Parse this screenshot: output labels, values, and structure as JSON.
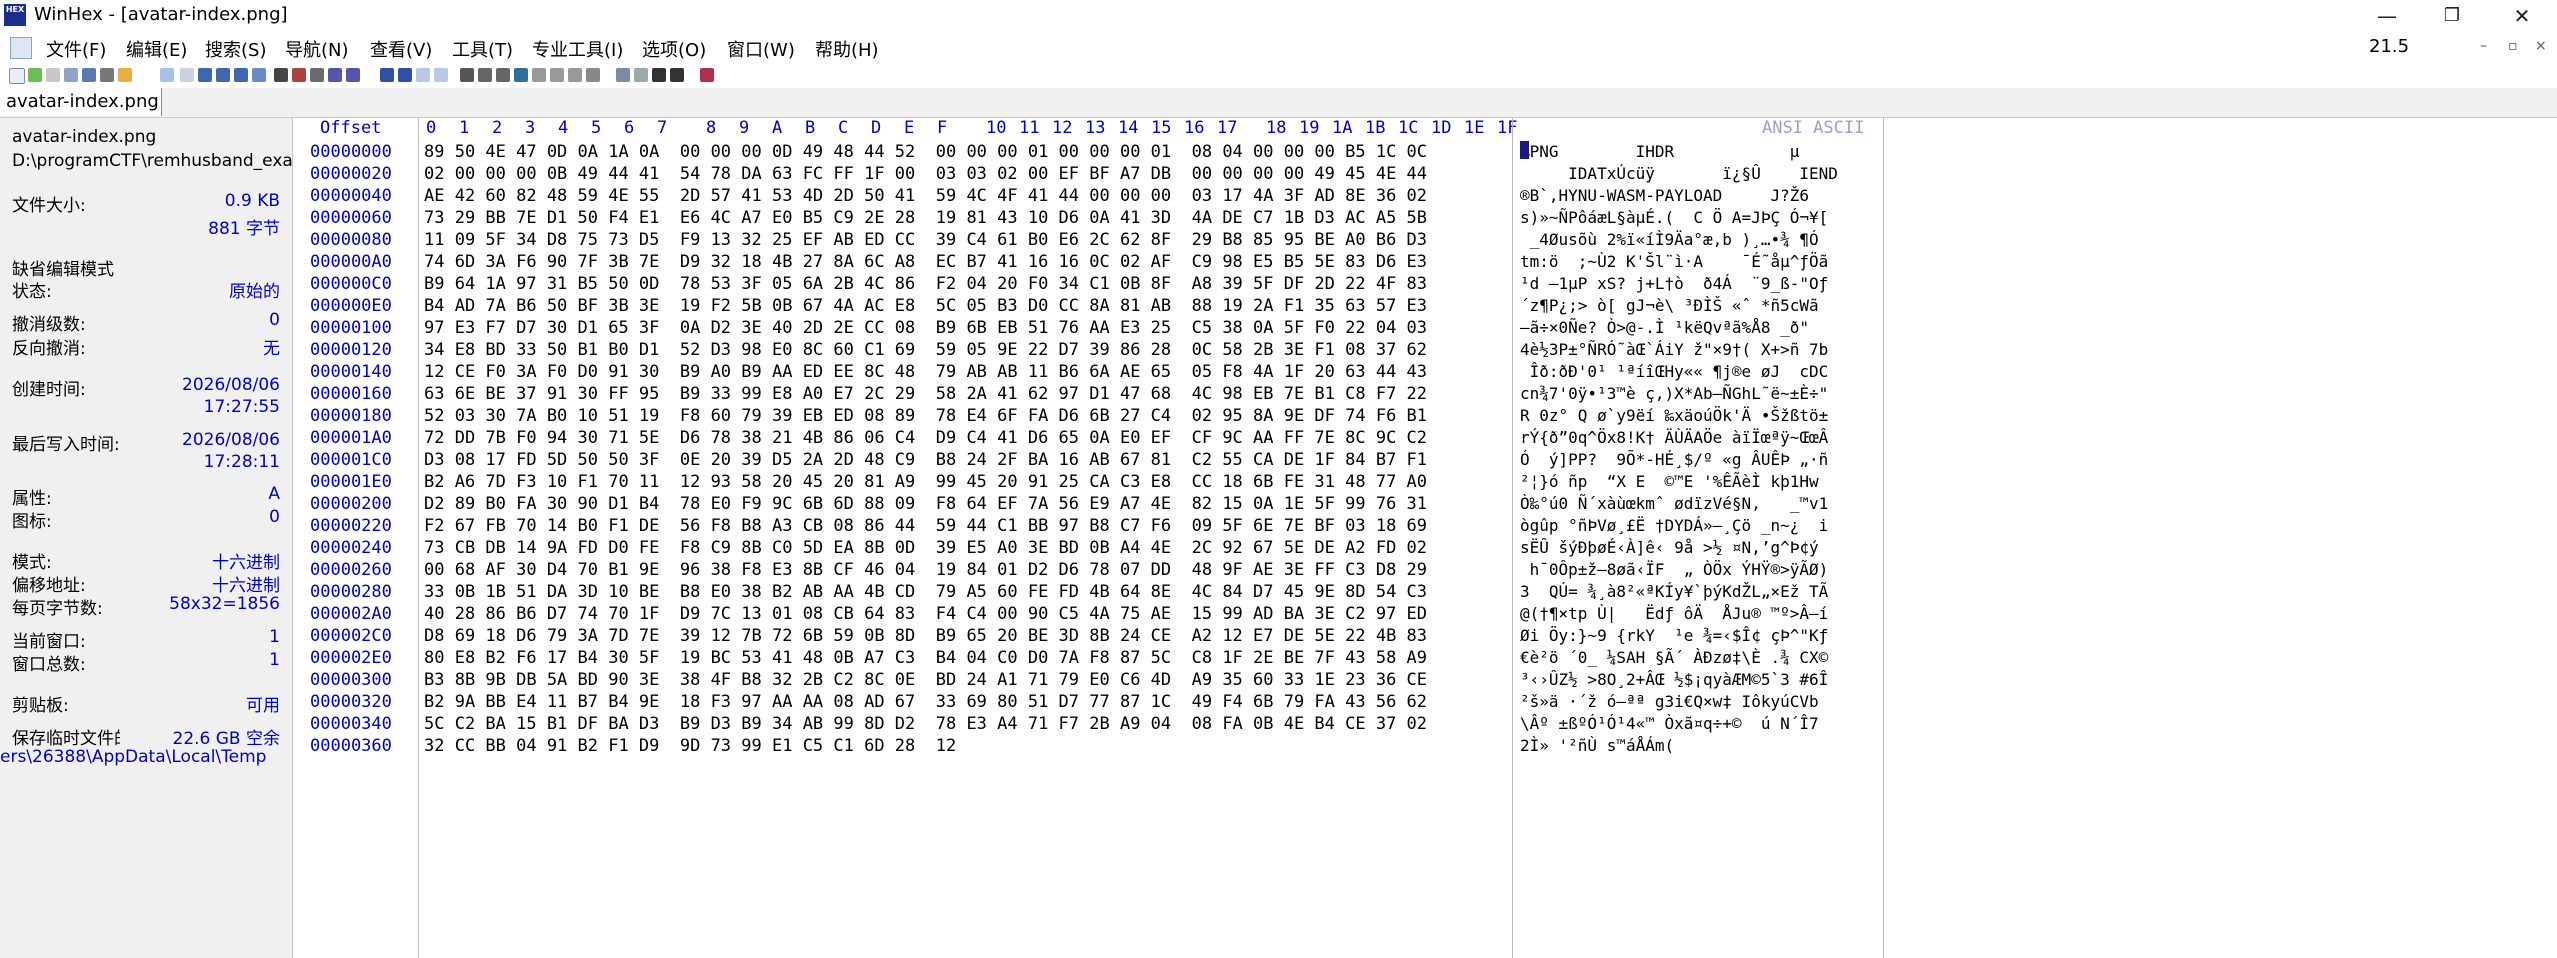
{
  "window": {
    "title": "WinHex - [avatar-index.png]",
    "icon_text": "HEX",
    "min_glyph": "—",
    "restore_glyph": "❐",
    "close_glyph": "✕"
  },
  "menu": [
    "文件(F)",
    "编辑(E)",
    "搜索(S)",
    "导航(N)",
    "查看(V)",
    "工具(T)",
    "专业工具(I)",
    "选项(O)",
    "窗口(W)",
    "帮助(H)"
  ],
  "zoom": "21.5",
  "tab": {
    "label": "avatar-index.png"
  },
  "info": {
    "filename": "avatar-index.png",
    "path": "D:\\programCTF\\remhusband_exa",
    "filesize_label": "文件大小:",
    "filesize_kb": "0.9 KB",
    "filesize_bytes": "881 字节",
    "edit_mode": "缺省编辑模式",
    "state_label": "状态:",
    "state_value": "原始的",
    "undo_label": "撤消级数:",
    "undo_value": "0",
    "redo_label": "反向撤消:",
    "redo_value": "无",
    "created_label": "创建时间:",
    "created_date": "2026/08/06",
    "created_time": "17:27:55",
    "modified_label": "最后写入时间:",
    "modified_date": "2026/08/06",
    "modified_time": "17:28:11",
    "attr_label": "属性:",
    "attr_value": "A",
    "icon_label": "图标:",
    "icon_value": "0",
    "mode_label": "模式:",
    "mode_value": "十六进制",
    "offset_label": "偏移地址:",
    "offset_value": "十六进制",
    "bpp_label": "每页字节数:",
    "bpp_value": "58x32=1856",
    "curwin_label": "当前窗口:",
    "curwin_value": "1",
    "totalwin_label": "窗口总数:",
    "totalwin_value": "1",
    "clip_label": "剪贴板:",
    "clip_value": "可用",
    "temp_label": "保存临时文件的目录为",
    "temp_free": "22.6 GB 空余",
    "temp_path": "ers\\26388\\AppData\\Local\\Temp"
  },
  "hex": {
    "offset_header": "Offset",
    "col_headers": [
      "0",
      "1",
      "2",
      "3",
      "4",
      "5",
      "6",
      "7",
      "8",
      "9",
      "A",
      "B",
      "C",
      "D",
      "E",
      "F",
      "10",
      "11",
      "12",
      "13",
      "14",
      "15",
      "16",
      "17",
      "18",
      "19",
      "1A",
      "1B",
      "1C",
      "1D",
      "1E",
      "1F"
    ],
    "ansi_header": "ANSI ASCII",
    "rows": [
      {
        "o": "00000000",
        "h": "89 50 4E 47 0D 0A 1A 0A  00 00 00 0D 49 48 44 52  00 00 00 01 00 00 00 01  08 04 00 00 00 B5 1C 0C",
        "a": "‰PNG        IHDR            µ"
      },
      {
        "o": "00000020",
        "h": "02 00 00 00 0B 49 44 41  54 78 DA 63 FC FF 1F 00  03 03 02 00 EF BF A7 DB  00 00 00 00 49 45 4E 44",
        "a": "     IDATxÚcüÿ       ï¿§Û    IEND"
      },
      {
        "o": "00000040",
        "h": "AE 42 60 82 48 59 4E 55  2D 57 41 53 4D 2D 50 41  59 4C 4F 41 44 00 00 00  03 17 4A 3F AD 8E 36 02",
        "a": "®B`‚HYNU-WASM-PAYLOAD     J?­Ž6"
      },
      {
        "o": "00000060",
        "h": "73 29 BB 7E D1 50 F4 E1  E6 4C A7 E0 B5 C9 2E 28  19 81 43 10 D6 0A 41 3D  4A DE C7 1B D3 AC A5 5B",
        "a": "s)»~ÑPôáæL§àµÉ.(  C Ö A=JÞÇ Ó¬¥["
      },
      {
        "o": "00000080",
        "h": "11 09 5F 34 D8 75 73 D5  F9 13 32 25 EF AB ED CC  39 C4 61 B0 E6 2C 62 8F  29 B8 85 95 BE A0 B6 D3",
        "a": " _4Øusõù 2%ï«íÌ9Äa°æ,b )¸…•¾ ¶Ó"
      },
      {
        "o": "000000A0",
        "h": "74 6D 3A F6 90 7F 3B 7E  D9 32 18 4B 27 8A 6C A8  EC B7 41 16 16 0C 02 AF  C9 98 E5 B5 5E 83 D6 E3",
        "a": "tm:ö  ;~Ù2 K'Šl¨ì·A    ¯É˜åµ^ƒÖã"
      },
      {
        "o": "000000C0",
        "h": "B9 64 1A 97 31 B5 50 0D  78 53 3F 05 6A 2B 4C 86  F2 04 20 F0 34 C1 0B 8F  A8 39 5F DF 2D 22 4F 83",
        "a": "¹d —1µP xS? j+L†ò  ð4Á  ¨9_ß-\"Oƒ"
      },
      {
        "o": "000000E0",
        "h": "B4 AD 7A B6 50 BF 3B 3E  19 F2 5B 0B 67 4A AC E8  5C 05 B3 D0 CC 8A 81 AB  88 19 2A F1 35 63 57 E3",
        "a": "´­z¶P¿;> ò[ gJ¬è\\ ³ÐÌŠ «ˆ *ñ5cWã"
      },
      {
        "o": "00000100",
        "h": "97 E3 F7 D7 30 D1 65 3F  0A D2 3E 40 2D 2E CC 08  B9 6B EB 51 76 AA E3 25  C5 38 0A 5F F0 22 04 03",
        "a": "—ã÷×0Ñe? Ò>@-.Ì ¹këQvªã%Å8 _ð\""
      },
      {
        "o": "00000120",
        "h": "34 E8 BD 33 50 B1 B0 D1  52 D3 98 E0 8C 60 C1 69  59 05 9E 22 D7 39 86 28  0C 58 2B 3E F1 08 37 62",
        "a": "4è½3P±°ÑRÓ˜àŒ`ÁiY ž\"×9†( X+>ñ 7b"
      },
      {
        "o": "00000140",
        "h": "12 CE F0 3A F0 D0 91 30  B9 A0 B9 AA ED EE 8C 48  79 AB AB 11 B6 6A AE 65  05 F8 4A 1F 20 63 44 43",
        "a": " Îð:ðÐ'0¹ ¹ªíîŒHy«« ¶j®e øJ  cDC"
      },
      {
        "o": "00000160",
        "h": "63 6E BE 37 91 30 FF 95  B9 33 99 E8 A0 E7 2C 29  58 2A 41 62 97 D1 47 68  4C 98 EB 7E B1 C8 F7 22",
        "a": "cn¾7'0ÿ•¹3™è ç,)X*Ab—ÑGhL˜ë~±È÷\""
      },
      {
        "o": "00000180",
        "h": "52 03 30 7A B0 10 51 19  F8 60 79 39 EB ED 08 89  78 E4 6F FA D6 6B 27 C4  02 95 8A 9E DF 74 F6 B1",
        "a": "R 0z° Q ø`y9ëí ‰xäoúÖk'Ä •Šžßtö±"
      },
      {
        "o": "000001A0",
        "h": "72 DD 7B F0 94 30 71 5E  D6 78 38 21 4B 86 06 C4  D9 C4 41 D6 65 0A E0 EF  CF 9C AA FF 7E 8C 9C C2",
        "a": "rÝ{ð”0q^Öx8!K† ÄÙÄAÖe àïÏœªÿ~ŒœÂ"
      },
      {
        "o": "000001C0",
        "h": "D3 08 17 FD 5D 50 50 3F  0E 20 39 D5 2A 2D 48 C9  B8 24 2F BA 16 AB 67 81  C2 55 CA DE 1F 84 B7 F1",
        "a": "Ó  ý]PP?  9Õ*-HÉ¸$/º «g ÂUÊÞ „·ñ"
      },
      {
        "o": "000001E0",
        "h": "B2 A6 7D F3 10 F1 70 11  12 93 58 20 45 20 81 A9  99 45 20 91 25 CA C3 E8  CC 18 6B FE 31 48 77 A0",
        "a": "²¦}ó ñp  “X E  ©™E '%ÊÃèÌ kþ1Hw "
      },
      {
        "o": "00000200",
        "h": "D2 89 B0 FA 30 90 D1 B4  78 E0 F9 9C 6B 6D 88 09  F8 64 EF 7A 56 E9 A7 4E  82 15 0A 1E 5F 99 76 31",
        "a": "Ò‰°ú0 Ñ´xàùœkmˆ ødïzVé§N‚   _™v1"
      },
      {
        "o": "00000220",
        "h": "F2 67 FB 70 14 B0 F1 DE  56 F8 B8 A3 CB 08 86 44  59 44 C1 BB 97 B8 C7 F6  09 5F 6E 7E BF 03 18 69",
        "a": "ògûp °ñÞVø¸£Ë †DYDÁ»—¸Çö _n~¿  i"
      },
      {
        "o": "00000240",
        "h": "73 CB DB 14 9A FD D0 FE  F8 C9 8B C0 5D EA 8B 0D  39 E5 A0 3E BD 0B A4 4E  2C 92 67 5E DE A2 FD 02",
        "a": "sËÛ šýÐþøÉ‹À]ê‹ 9å >½ ¤N,’g^Þ¢ý "
      },
      {
        "o": "00000260",
        "h": "00 68 AF 30 D4 70 B1 9E  96 38 F8 E3 8B CF 46 04  19 84 01 D2 D6 78 07 DD  48 9F AE 3E FF C3 D8 29",
        "a": " h¯0Ôp±ž–8øã‹ÏF  „ ÒÖx ÝHŸ®>ÿÃØ)"
      },
      {
        "o": "00000280",
        "h": "33 0B 1B 51 DA 3D 10 BE  B8 E0 38 B2 AB AA 4B CD  79 A5 60 FE FD 4B 64 8E  4C 84 D7 45 9E 8D 54 C3",
        "a": "3  QÚ= ¾¸à8²«ªKÍy¥`þýKdŽL„×Ež TÃ"
      },
      {
        "o": "000002A0",
        "h": "40 28 86 B6 D7 74 70 1F  D9 7C 13 01 08 CB 64 83  F4 C4 00 90 C5 4A 75 AE  15 99 AD BA 3E C2 97 ED",
        "a": "@(†¶×tp Ù|   Ëdƒ ôÄ  ÅJu® ™­º>Â—í"
      },
      {
        "o": "000002C0",
        "h": "D8 69 18 D6 79 3A 7D 7E  39 12 7B 72 6B 59 0B 8D  B9 65 20 BE 3D 8B 24 CE  A2 12 E7 DE 5E 22 4B 83",
        "a": "Øi Öy:}~9 {rkY  ¹e ¾=‹$Î¢ çÞ^\"Kƒ"
      },
      {
        "o": "000002E0",
        "h": "80 E8 B2 F6 17 B4 30 5F  19 BC 53 41 48 0B A7 C3  B4 04 C0 D0 7A F8 87 5C  C8 1F 2E BE 7F 43 58 A9",
        "a": "€è²ö ´0_ ¼SAH §Ã´ ÀÐzø‡\\È .¾ CX©"
      },
      {
        "o": "00000300",
        "h": "B3 8B 9B DB 5A BD 90 3E  38 4F B8 32 2B C2 8C 0E  BD 24 A1 71 79 E0 C6 4D  A9 35 60 33 1E 23 36 CE",
        "a": "³‹›ÛZ½ >8O¸2+ÂŒ ½$¡qyàÆM©5`3 #6Î"
      },
      {
        "o": "00000320",
        "h": "B2 9A BB E4 11 B7 B4 9E  18 F3 97 AA AA 08 AD 67  33 69 80 51 D7 77 87 1C  49 F4 6B 79 FA 43 56 62",
        "a": "²š»ä ·´ž ó—ªª ­g3i€Q×w‡ IôkyúCVb"
      },
      {
        "o": "00000340",
        "h": "5C C2 BA 15 B1 DF BA D3  B9 D3 B9 34 AB 99 8D D2  78 E3 A4 71 F7 2B A9 04  08 FA 0B 4E B4 CE 37 02",
        "a": "\\Âº ±ßºÓ¹Ó¹4«™ Òxã¤q÷+©  ú N´Î7 "
      },
      {
        "o": "00000360",
        "h": "32 CC BB 04 91 B2 F1 D9  9D 73 99 E1 C5 C1 6D 28  12",
        "a": "2Ì» '²ñÙ s™áÅÁm("
      }
    ]
  },
  "colors": {
    "accent": "#0000c0",
    "panel_bg": "#f0f0f0",
    "grid": "#b8b8b8"
  }
}
